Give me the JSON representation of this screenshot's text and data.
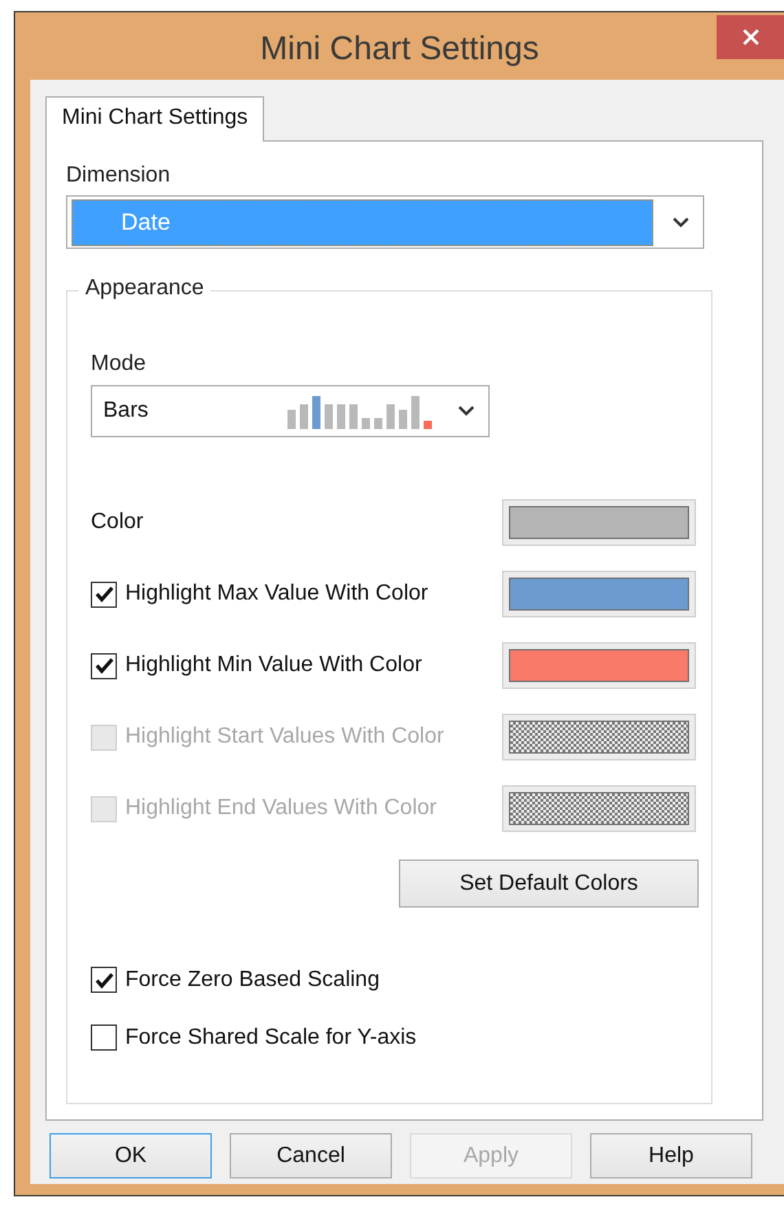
{
  "window": {
    "title": "Mini Chart Settings"
  },
  "tabs": [
    {
      "label": "Mini Chart Settings",
      "selected": true
    }
  ],
  "dimension": {
    "label": "Dimension",
    "value": "Date"
  },
  "appearance": {
    "title": "Appearance",
    "mode": {
      "label": "Mode",
      "value": "Bars"
    },
    "color_rows": [
      {
        "kind": "plain",
        "label": "Color",
        "disabled": false,
        "color": "#b4b4b4"
      },
      {
        "kind": "checkbox",
        "label": "Highlight Max Value With Color",
        "checked": true,
        "disabled": false,
        "color": "#6b9bd1"
      },
      {
        "kind": "checkbox",
        "label": "Highlight Min Value With Color",
        "checked": true,
        "disabled": false,
        "color": "#fa7a6a"
      },
      {
        "kind": "checkbox",
        "label": "Highlight Start Values With Color",
        "checked": false,
        "disabled": true
      },
      {
        "kind": "checkbox",
        "label": "Highlight End Values With Color",
        "checked": false,
        "disabled": true
      }
    ],
    "default_button": "Set Default Colors",
    "options": [
      {
        "label": "Force Zero Based Scaling",
        "checked": true
      },
      {
        "label": "Force Shared Scale for Y-axis",
        "checked": false
      }
    ]
  },
  "buttons": [
    {
      "label": "OK",
      "default": true,
      "disabled": false
    },
    {
      "label": "Cancel",
      "default": false,
      "disabled": false
    },
    {
      "label": "Apply",
      "default": false,
      "disabled": true
    },
    {
      "label": "Help",
      "default": false,
      "disabled": false
    }
  ]
}
